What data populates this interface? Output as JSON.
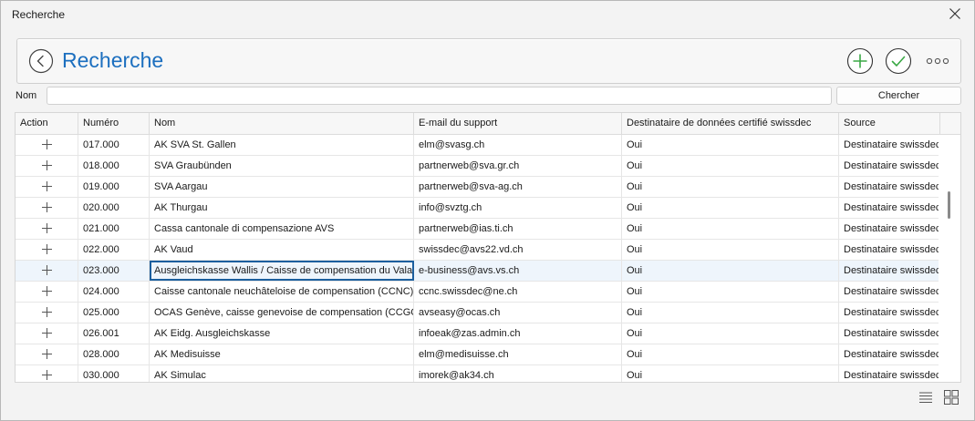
{
  "window": {
    "title": "Recherche"
  },
  "header": {
    "title": "Recherche"
  },
  "search": {
    "label": "Nom",
    "value": "",
    "placeholder": "",
    "button_label": "Chercher"
  },
  "icons": {
    "close": "close-icon",
    "back": "back-arrow-icon",
    "add": "add-circle-icon",
    "confirm": "checkmark-circle-icon",
    "more": "more-dots-icon",
    "row_add": "plus-icon",
    "list_view": "list-view-icon",
    "grid_view": "grid-view-icon"
  },
  "colors": {
    "accent": "#1c6fbf",
    "action_green": "#3aa845"
  },
  "table": {
    "columns": [
      "Action",
      "Numéro",
      "Nom",
      "E-mail du support",
      "Destinataire de données certifié swissdec",
      "Source"
    ],
    "rows": [
      {
        "num": "017.000",
        "nom": "AK SVA St. Gallen",
        "email": "elm@svasg.ch",
        "dest": "Oui",
        "src": "Destinataire swissdec"
      },
      {
        "num": "018.000",
        "nom": "SVA Graubünden",
        "email": "partnerweb@sva.gr.ch",
        "dest": "Oui",
        "src": "Destinataire swissdec"
      },
      {
        "num": "019.000",
        "nom": "SVA Aargau",
        "email": "partnerweb@sva-ag.ch",
        "dest": "Oui",
        "src": "Destinataire swissdec"
      },
      {
        "num": "020.000",
        "nom": "AK Thurgau",
        "email": "info@svztg.ch",
        "dest": "Oui",
        "src": "Destinataire swissdec"
      },
      {
        "num": "021.000",
        "nom": "Cassa cantonale di compensazione AVS",
        "email": "partnerweb@ias.ti.ch",
        "dest": "Oui",
        "src": "Destinataire swissdec"
      },
      {
        "num": "022.000",
        "nom": "AK Vaud",
        "email": "swissdec@avs22.vd.ch",
        "dest": "Oui",
        "src": "Destinataire swissdec"
      },
      {
        "num": "023.000",
        "nom": "Ausgleichskasse Wallis / Caisse de compensation du Valais",
        "email": "e-business@avs.vs.ch",
        "dest": "Oui",
        "src": "Destinataire swissdec"
      },
      {
        "num": "024.000",
        "nom": "Caisse cantonale neuchâteloise de compensation (CCNC)",
        "email": "ccnc.swissdec@ne.ch",
        "dest": "Oui",
        "src": "Destinataire swissdec"
      },
      {
        "num": "025.000",
        "nom": "OCAS Genève, caisse genevoise de compensation (CCGC)",
        "email": "avseasy@ocas.ch",
        "dest": "Oui",
        "src": "Destinataire swissdec"
      },
      {
        "num": "026.001",
        "nom": "AK Eidg. Ausgleichskasse",
        "email": "infoeak@zas.admin.ch",
        "dest": "Oui",
        "src": "Destinataire swissdec"
      },
      {
        "num": "028.000",
        "nom": "AK Medisuisse",
        "email": "elm@medisuisse.ch",
        "dest": "Oui",
        "src": "Destinataire swissdec"
      },
      {
        "num": "030.000",
        "nom": "AK Simulac",
        "email": "imorek@ak34.ch",
        "dest": "Oui",
        "src": "Destinataire swissdec"
      }
    ],
    "selected_row_index": 6
  }
}
